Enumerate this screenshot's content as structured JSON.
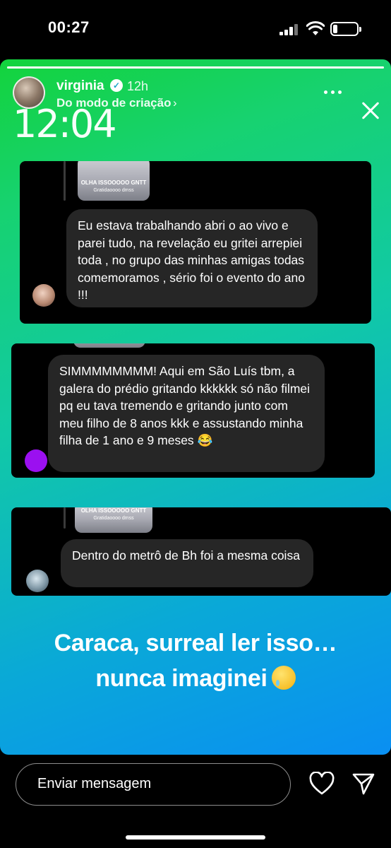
{
  "status_bar": {
    "time": "00:27"
  },
  "story": {
    "progress": 1.0,
    "user": {
      "username": "virginia",
      "verified_icon": "verified-badge-icon",
      "time_ago": "12h"
    },
    "subtitle": "Do modo de criação",
    "subtitle_arrow": "›",
    "overlay_clock": "12:04",
    "thumbnail": {
      "caption_line1": "OLHA ISSOOOOO GNTT",
      "caption_line2": "Gratidaoooo dmss"
    },
    "messages": [
      {
        "text": "Eu estava trabalhando abri o ao vivo e parei tudo, na revelação eu gritei arrepiei toda , no grupo das minhas amigas todas comemoramos , sério foi o evento do ano !!!"
      },
      {
        "text": "SIMMMMMMMM! Aqui em São Luís tbm, a galera do prédio gritando kkkkkk só não filmei pq eu tava tremendo e gritando junto com meu filho de 8 anos kkk e assustando minha filha de 1 ano e 9 meses 😂"
      },
      {
        "text": "Dentro do metrô de Bh foi a mesma coisa"
      }
    ],
    "caption_line1": "Caraca, surreal ler isso…",
    "caption_line2": "nunca imaginei",
    "caption_emoji": "crying-face-icon"
  },
  "footer": {
    "message_placeholder": "Enviar mensagem"
  },
  "colors": {
    "gradient_top": "#13d33c",
    "gradient_bottom": "#0a8ff2",
    "bubble": "#262626"
  }
}
